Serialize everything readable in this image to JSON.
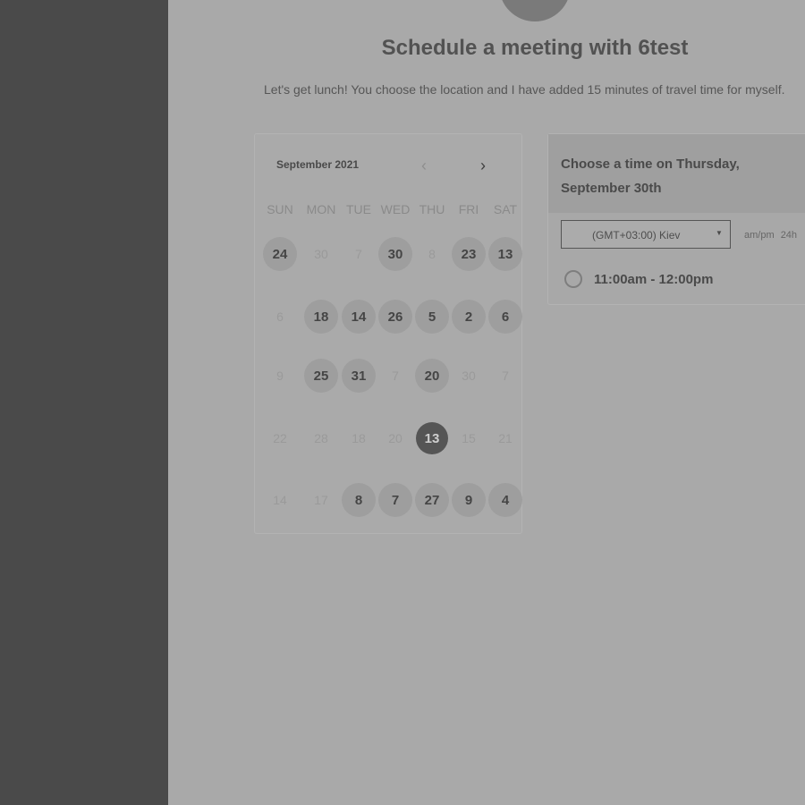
{
  "header": {
    "title": "Schedule a meeting with 6test",
    "subtitle": "Let's get lunch! You choose the location and I have added 15 minutes of travel time for myself."
  },
  "calendar": {
    "month_label": "September 2021",
    "weekdays": [
      "SUN",
      "MON",
      "TUE",
      "WED",
      "THU",
      "FRI",
      "SAT"
    ],
    "weeks": [
      [
        {
          "d": "24",
          "s": "avail"
        },
        {
          "d": "30",
          "s": "dim"
        },
        {
          "d": "7",
          "s": "dim"
        },
        {
          "d": "30",
          "s": "avail"
        },
        {
          "d": "8",
          "s": "dim"
        },
        {
          "d": "23",
          "s": "avail"
        },
        {
          "d": "13",
          "s": "avail"
        }
      ],
      [
        {
          "d": "6",
          "s": "dim"
        },
        {
          "d": "18",
          "s": "avail"
        },
        {
          "d": "14",
          "s": "avail"
        },
        {
          "d": "26",
          "s": "avail"
        },
        {
          "d": "5",
          "s": "avail"
        },
        {
          "d": "2",
          "s": "avail"
        },
        {
          "d": "6",
          "s": "avail"
        }
      ],
      [
        {
          "d": "9",
          "s": "dim"
        },
        {
          "d": "25",
          "s": "avail"
        },
        {
          "d": "31",
          "s": "avail"
        },
        {
          "d": "7",
          "s": "dim"
        },
        {
          "d": "20",
          "s": "avail"
        },
        {
          "d": "30",
          "s": "dim"
        },
        {
          "d": "7",
          "s": "dim"
        }
      ],
      [
        {
          "d": "22",
          "s": "dim"
        },
        {
          "d": "28",
          "s": "dim"
        },
        {
          "d": "18",
          "s": "dim"
        },
        {
          "d": "20",
          "s": "dim"
        },
        {
          "d": "13",
          "s": "sel"
        },
        {
          "d": "15",
          "s": "dim"
        },
        {
          "d": "21",
          "s": "dim"
        }
      ],
      [
        {
          "d": "14",
          "s": "dim"
        },
        {
          "d": "17",
          "s": "dim"
        },
        {
          "d": "8",
          "s": "avail"
        },
        {
          "d": "7",
          "s": "avail"
        },
        {
          "d": "27",
          "s": "avail"
        },
        {
          "d": "9",
          "s": "avail"
        },
        {
          "d": "4",
          "s": "avail"
        }
      ]
    ]
  },
  "time_panel": {
    "title": "Choose a time on Thursday, September 30th",
    "timezone": "(GMT+03:00) Kiev",
    "format_ampm": "am/pm",
    "format_24h": "24h",
    "slots": [
      {
        "label": "11:00am - 12:00pm"
      }
    ]
  },
  "icons": {
    "prev": "chevron-left-icon",
    "next": "chevron-right-icon",
    "dropdown": "caret-down-icon"
  }
}
